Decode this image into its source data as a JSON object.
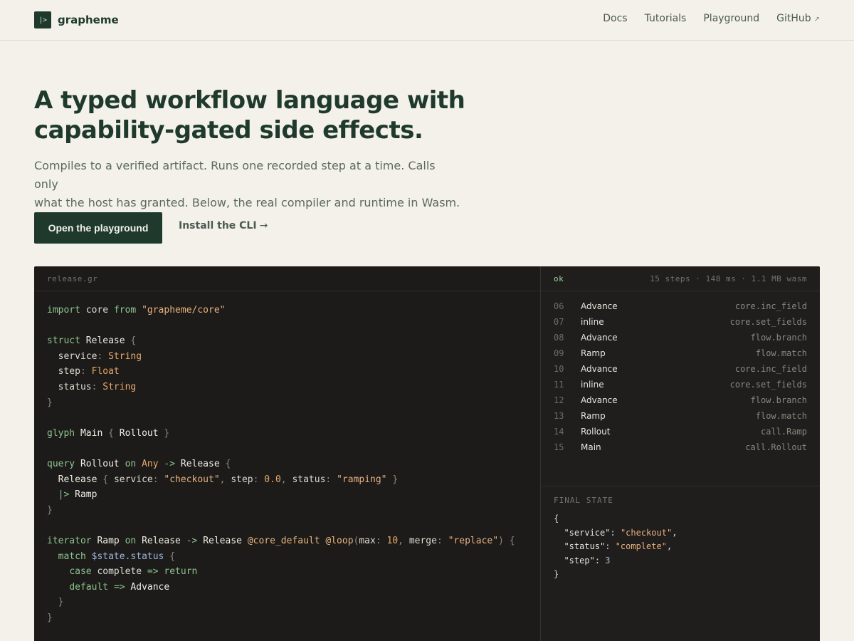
{
  "nav": {
    "logo_glyph": "|>",
    "brand": "grapheme",
    "links": [
      {
        "label": "Docs"
      },
      {
        "label": "Tutorials"
      },
      {
        "label": "Playground"
      },
      {
        "label": "GitHub",
        "external_icon": "↗"
      }
    ]
  },
  "hero": {
    "title_line1": "A typed workflow language with",
    "title_line2": "capability-gated side effects.",
    "subtitle_line1": "Compiles to a verified artifact. Runs one recorded step at a time. Calls only",
    "subtitle_line2": "what the host has granted. Below, the real compiler and runtime in Wasm.",
    "primary_cta": "Open the playground",
    "secondary_cta": "Install the CLI",
    "secondary_arrow": "→"
  },
  "editor": {
    "filename": "release.gr",
    "tokens": {
      "import": "import",
      "core": "core",
      "from": "from",
      "core_path": "\"grapheme/core\"",
      "struct": "struct",
      "Release": "Release",
      "lbrace": "{",
      "rbrace": "}",
      "service": "service",
      "step": "step",
      "status": "status",
      "colon": ":",
      "String": "String",
      "Float": "Float",
      "glyph": "glyph",
      "Main": "Main",
      "Rollout": "Rollout",
      "query": "query",
      "on": "on",
      "Any": "Any",
      "arrow": "->",
      "checkout": "\"checkout\"",
      "comma": ",",
      "zero": "0.0",
      "ramping": "\"ramping\"",
      "pipe": "|>",
      "Ramp": "Ramp",
      "iterator": "iterator",
      "core_default": "@core_default",
      "loop": "@loop",
      "lparen": "(",
      "rparen": ")",
      "max": "max",
      "ten": "10",
      "merge": "merge",
      "replace": "\"replace\"",
      "match": "match",
      "state_status": "$state.status",
      "case": "case",
      "complete": "complete",
      "fat_arrow": "=>",
      "return": "return",
      "default": "default",
      "Advance": "Advance"
    }
  },
  "runtime": {
    "status": "ok",
    "stats": "15 steps · 148 ms · 1.1 MB wasm",
    "steps": [
      {
        "n": "06",
        "name": "Advance",
        "call": "core.inc_field"
      },
      {
        "n": "07",
        "name": "inline",
        "call": "core.set_fields"
      },
      {
        "n": "08",
        "name": "Advance",
        "call": "flow.branch"
      },
      {
        "n": "09",
        "name": "Ramp",
        "call": "flow.match"
      },
      {
        "n": "10",
        "name": "Advance",
        "call": "core.inc_field"
      },
      {
        "n": "11",
        "name": "inline",
        "call": "core.set_fields"
      },
      {
        "n": "12",
        "name": "Advance",
        "call": "flow.branch"
      },
      {
        "n": "13",
        "name": "Ramp",
        "call": "flow.match"
      },
      {
        "n": "14",
        "name": "Rollout",
        "call": "call.Ramp"
      },
      {
        "n": "15",
        "name": "Main",
        "call": "call.Rollout"
      }
    ],
    "final_label": "FINAL STATE",
    "final_state": {
      "open": "{",
      "close": "}",
      "k_service": "\"service\"",
      "v_service": "\"checkout\"",
      "k_status": "\"status\"",
      "v_status": "\"complete\"",
      "k_step": "\"step\"",
      "v_step": "3"
    }
  },
  "colors": {
    "accent": "#1f3a2d",
    "background": "#f3f1ea",
    "code_bg": "#1c1b19"
  }
}
